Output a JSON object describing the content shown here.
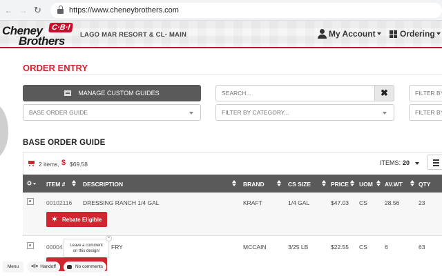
{
  "browser": {
    "url": "https://www.cheneybrothers.com"
  },
  "header": {
    "logo_line1": "Cheney",
    "logo_line2": "Brothers",
    "logo_badge": "C·B·I",
    "location": "LAGO MAR RESORT & CL- MAIN",
    "my_account": "My Account",
    "ordering": "Ordering"
  },
  "page": {
    "title": "ORDER ENTRY",
    "manage_custom_guides": "MANAGE CUSTOM GUIDES",
    "search_placeholder": "SEARCH...",
    "filter_by_right_1": "FILTER BY",
    "base_order_guide_select": "BASE ORDER GUIDE",
    "filter_by_category": "FILTER BY CATEGORY...",
    "filter_by_right_2": "FILTER BY",
    "section_title": "BASE ORDER GUIDE"
  },
  "summary": {
    "items": "2 items,",
    "currency": "$",
    "total": "$69.58",
    "items_label": "ITEMS:",
    "items_per_page": "20"
  },
  "table": {
    "headers": {
      "item": "ITEM #",
      "description": "DESCRIPTION",
      "brand": "BRAND",
      "cs_size": "CS SIZE",
      "price": "PRICE",
      "uom": "UOM",
      "av_wt": "AV.WT",
      "qty": "QTY"
    },
    "rows": [
      {
        "item": "00102116",
        "description": "DRESSING RANCH 1/4 GAL",
        "brand": "KRAFT",
        "cs_size": "1/4 GAL",
        "price": "$47.03",
        "uom": "CS",
        "av_wt": "28.56",
        "qty": "23",
        "rebate": "Rebate Eligible"
      },
      {
        "item": "00004",
        "description": "FRY",
        "brand": "MCCAIN",
        "cs_size": "3/25 LB",
        "price": "$22.55",
        "uom": "CS",
        "av_wt": "6",
        "qty": "63"
      }
    ]
  },
  "overlay": {
    "comment_tip_line1": "Leave a comment",
    "comment_tip_line2": "on this design!",
    "close": "×",
    "menu": "Menu",
    "handoff": "Handoff",
    "comments": "No comments"
  },
  "colors": {
    "brand_red": "#c8102e",
    "title_red": "#d0262f",
    "header_dark": "#5a5a5a"
  }
}
